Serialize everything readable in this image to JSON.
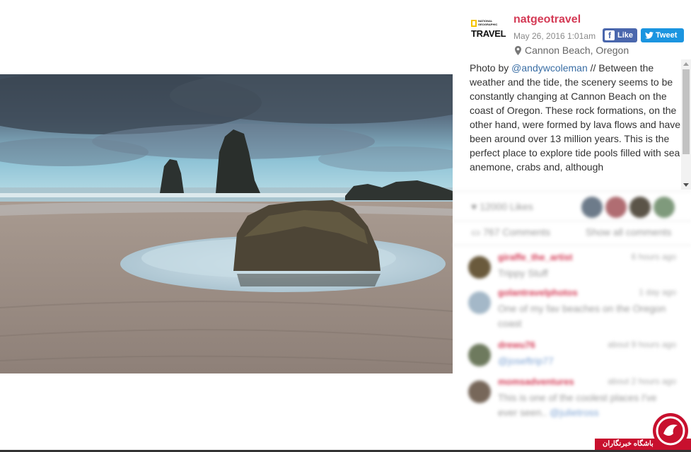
{
  "post": {
    "username": "natgeotravel",
    "date": "May 26, 2016 1:01am",
    "location": "Cannon Beach, Oregon",
    "logo": {
      "top": "NATIONAL GEOGRAPHIC",
      "brand": "TRAVEL"
    },
    "caption": {
      "prefix": "Photo by ",
      "mention": "@andywcoleman",
      "body": " // Between the weather and the tide, the scenery seems to be constantly changing at Cannon Beach on the coast of Oregon. These rock formations, on the other hand, were formed by lava flows and have been around over 13 million years. This is the perfect place to explore tide pools filled with sea anemone, crabs and, although"
    }
  },
  "share": {
    "like_label": "Like",
    "tweet_label": "Tweet",
    "facebook_color": "#4a67ad",
    "twitter_color": "#1b95e0"
  },
  "stats": {
    "likes": "12000 Likes",
    "comments": "767 Comments",
    "show_all": "Show all comments"
  },
  "comments": [
    {
      "user": "giraffe_the_artist",
      "time": "6 hours ago",
      "text": "Trippy Stuff"
    },
    {
      "user": "golantravelphotos",
      "time": "1 day ago",
      "text": "One of my fav beaches on the Oregon coast"
    },
    {
      "user": "drewu76",
      "time": "about 9 hours ago",
      "mention": "@joseftrip77"
    },
    {
      "user": "momsadventures",
      "time": "about 2 hours ago",
      "text": "This is one of the coolest places I've ever seen..",
      "mention": "@julietross"
    }
  ],
  "watermark": {
    "text": "باشگاه خبرنگاران",
    "color": "#c8102e"
  },
  "colors": {
    "username": "#d43a55",
    "mention": "#3a6ea5"
  },
  "icons": [
    "national-geographic-logo",
    "facebook-icon",
    "twitter-icon",
    "location-pin-icon",
    "heart-icon",
    "comment-icon"
  ]
}
